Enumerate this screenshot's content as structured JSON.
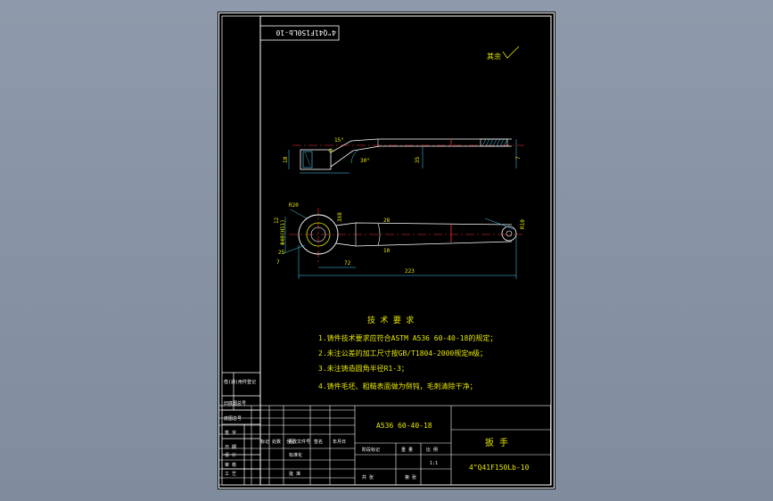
{
  "drawing_number_rotated": "4\"Q41F150Lb-10",
  "surface_note": "其余",
  "dimensions": {
    "thickness_side": "10",
    "angle_15": "15°",
    "angle_30": "30°",
    "length_35": "35",
    "width_7": "7",
    "radius_20": "R20",
    "hole": "3X8",
    "dim_12": "12",
    "diameter": "Φ40(H11)",
    "dim_25": "25",
    "dim_7": "7",
    "wall_28": "28",
    "dim_10": "10",
    "depth_72": "72",
    "overall_223": "223",
    "radius_10": "R10"
  },
  "tech_requirements": {
    "title": "技 术 要 求",
    "items": [
      "1.铸件技术要求应符合ASTM A536 60-40-18的规定；",
      "2.未注公差的加工尺寸按GB/T1804-2000规定m级；",
      "3.未注铸造圆角半径R1-3；",
      "4.铸件毛坯、粗糙表面做为倒钝，毛刺清除干净；"
    ]
  },
  "title_block": {
    "material": "A536 60-40-18",
    "part_name": "扳 手",
    "drawing_number": "4\"Q41F150Lb-10",
    "labels": {
      "design": "设 计",
      "check": "审 核",
      "approve": "批 准",
      "process": "工 艺",
      "standardize": "标准化",
      "stage_marking": "阶段标记",
      "weight": "重 量",
      "ratio": "比 例",
      "scale_value": "1:1",
      "sheet_total": "共 张",
      "sheet_no": "第 张",
      "marks": "标记",
      "count": "处数",
      "zone": "分区",
      "change_doc": "更改文件号",
      "signature": "签名",
      "date": "年月日"
    },
    "side_strip": [
      "借(通)用件登记",
      "旧底图总号",
      "底图总号",
      "签 字",
      "日 期"
    ]
  }
}
